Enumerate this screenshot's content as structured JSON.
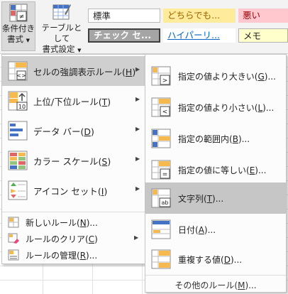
{
  "ribbon": {
    "cond_format_line1": "条件付き",
    "cond_format_line2": "書式",
    "table_format_line1": "テーブルとして",
    "table_format_line2": "書式設定",
    "styles": [
      {
        "label": "標準",
        "bg": "#ffffff",
        "color": "#222222"
      },
      {
        "label": "どちらでも...",
        "bg": "#ffeb9c",
        "color": "#9c6500"
      },
      {
        "label": "悪い",
        "bg": "#ffc7ce",
        "color": "#9c0006"
      },
      {
        "label": "チェック セ...",
        "bg": "#a5a5a5",
        "color": "#ffffff"
      },
      {
        "label": "ハイパーリ...",
        "bg": "#ffffff",
        "color": "#0563c1"
      },
      {
        "label": "メモ",
        "bg": "#ffffcc",
        "color": "#222222"
      }
    ]
  },
  "menu": {
    "items": [
      {
        "label": "セルの強調表示ルール",
        "key": "H",
        "icon": "highlight-cells-rules-icon"
      },
      {
        "label": "上位/下位ルール",
        "key": "T",
        "icon": "top-bottom-rules-icon",
        "icon_text": "10"
      },
      {
        "label": "データ バー",
        "key": "D",
        "icon": "data-bars-icon"
      },
      {
        "label": "カラー スケール",
        "key": "S",
        "icon": "color-scales-icon"
      },
      {
        "label": "アイコン セット",
        "key": "I",
        "icon": "icon-sets-icon"
      }
    ],
    "small_items": [
      {
        "label": "新しいルール",
        "key": "N",
        "icon": "new-rule-icon"
      },
      {
        "label": "ルールのクリア",
        "key": "C",
        "icon": "clear-rules-icon"
      },
      {
        "label": "ルールの管理",
        "key": "R",
        "icon": "manage-rules-icon"
      }
    ]
  },
  "submenu": {
    "items": [
      {
        "label": "指定の値より大きい",
        "key": "G",
        "icon": "greater-than-icon",
        "symbol": ">"
      },
      {
        "label": "指定の値より小さい",
        "key": "L",
        "icon": "less-than-icon",
        "symbol": "<"
      },
      {
        "label": "指定の範囲内",
        "key": "B",
        "icon": "between-icon",
        "symbol": ""
      },
      {
        "label": "指定の値に等しい",
        "key": "E",
        "icon": "equal-to-icon",
        "symbol": "="
      },
      {
        "label": "文字列",
        "key": "T",
        "icon": "text-contains-icon",
        "symbol": "ab"
      },
      {
        "label": "日付",
        "key": "A",
        "icon": "date-occurring-icon",
        "symbol": ""
      },
      {
        "label": "重複する値",
        "key": "D",
        "icon": "duplicate-values-icon",
        "symbol": ""
      }
    ],
    "more": {
      "label": "その他のルール",
      "key": "M"
    }
  },
  "colors": {
    "selected": "#c6c6c6",
    "accent": "#f6b94d",
    "blue": "#4472c4"
  }
}
